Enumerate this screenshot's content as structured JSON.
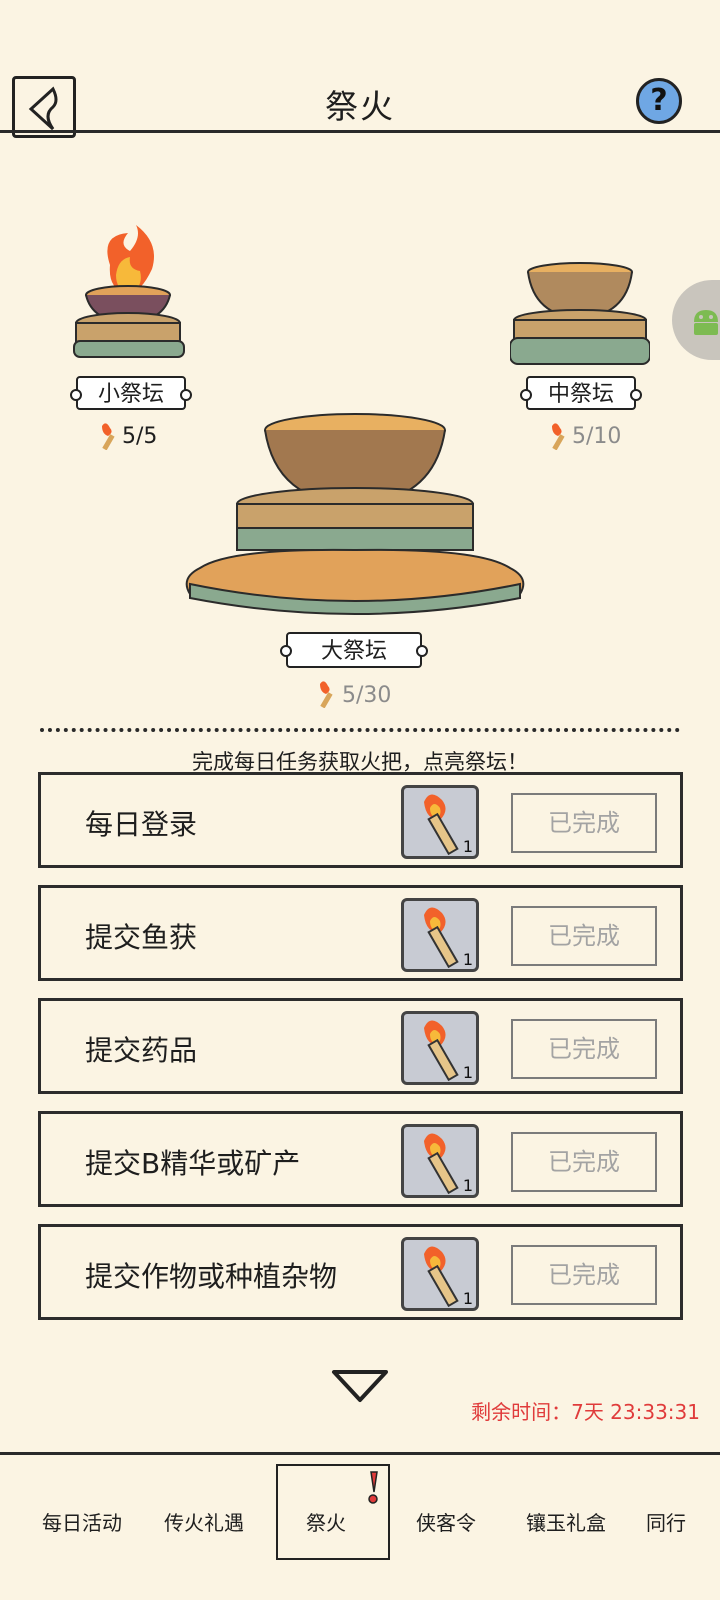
{
  "header": {
    "title": "祭火",
    "help_label": "?"
  },
  "altars": {
    "small": {
      "label": "小祭坛",
      "count": "5/5"
    },
    "medium": {
      "label": "中祭坛",
      "count": "5/10"
    },
    "large": {
      "label": "大祭坛",
      "count": "5/30"
    }
  },
  "hint": "完成每日任务获取火把，点亮祭坛！",
  "tasks": [
    {
      "name": "每日登录",
      "reward_qty": "1",
      "status": "已完成"
    },
    {
      "name": "提交鱼获",
      "reward_qty": "1",
      "status": "已完成"
    },
    {
      "name": "提交药品",
      "reward_qty": "1",
      "status": "已完成"
    },
    {
      "name": "提交B精华或矿产",
      "reward_qty": "1",
      "status": "已完成"
    },
    {
      "name": "提交作物或种植杂物",
      "reward_qty": "1",
      "status": "已完成"
    }
  ],
  "remaining_time": "剩余时间：7天 23:33:31",
  "nav": {
    "items": [
      "每日活动",
      "传火礼遇",
      "祭火",
      "侠客令",
      "镶玉礼盒",
      "同行"
    ],
    "active_index": 2
  },
  "colors": {
    "background": "#fbf4e3",
    "accent_red": "#e03b3b",
    "help_blue": "#6fa7e4"
  },
  "icons": [
    "back-icon",
    "help-icon",
    "torch-icon",
    "chevron-down-icon",
    "android-icon"
  ]
}
